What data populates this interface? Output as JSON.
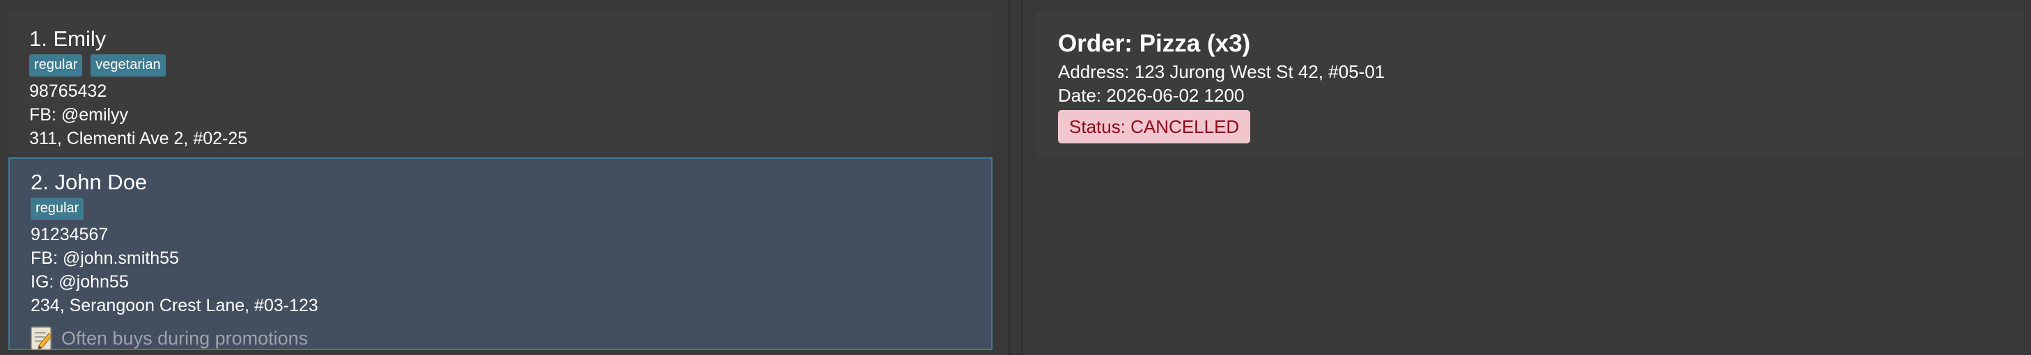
{
  "persons": [
    {
      "index_name": "1. Emily",
      "tags": [
        "regular",
        "vegetarian"
      ],
      "phone": "98765432",
      "facebook": "FB: @emilyy",
      "address": "311, Clementi Ave 2, #02-25"
    },
    {
      "index_name": "2. John Doe",
      "tags": [
        "regular"
      ],
      "phone": "91234567",
      "facebook": "FB: @john.smith55",
      "instagram": "IG: @john55",
      "address": "234, Serangoon Crest Lane, #03-123",
      "note": "Often buys during promotions",
      "note_icon": "memo-icon"
    }
  ],
  "order": {
    "title": "Order: Pizza (x3)",
    "address": "Address: 123 Jurong West St 42, #05-01",
    "date": "Date: 2026-06-02 1200",
    "status": "Status: CANCELLED"
  },
  "colors": {
    "background": "#383838",
    "card": "#3c3c3c",
    "selected_card": "#434e5f",
    "selected_border": "#3f7a95",
    "tag": "#3e7b91",
    "status_bg": "#f2c6cf",
    "status_text": "#8b0a1e"
  }
}
